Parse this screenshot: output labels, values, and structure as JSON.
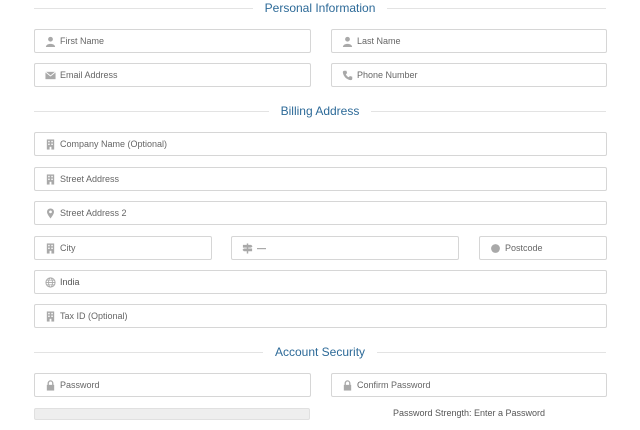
{
  "sections": {
    "personal": "Personal Information",
    "billing": "Billing Address",
    "security": "Account Security"
  },
  "fields": {
    "first_name": {
      "placeholder": "First Name",
      "icon": "person-icon"
    },
    "last_name": {
      "placeholder": "Last Name",
      "icon": "person-icon"
    },
    "email": {
      "placeholder": "Email Address",
      "icon": "envelope-icon"
    },
    "phone": {
      "placeholder": "Phone Number",
      "icon": "phone-icon"
    },
    "company": {
      "placeholder": "Company Name (Optional)",
      "icon": "building-icon"
    },
    "street": {
      "placeholder": "Street Address",
      "icon": "building-icon"
    },
    "street2": {
      "placeholder": "Street Address 2",
      "icon": "map-pin-icon"
    },
    "city": {
      "placeholder": "City",
      "icon": "building-icon"
    },
    "state": {
      "value": "—",
      "icon": "signpost-icon"
    },
    "postcode": {
      "placeholder": "Postcode",
      "icon": "circle-icon"
    },
    "country": {
      "value": "India",
      "icon": "globe-icon"
    },
    "tax_id": {
      "placeholder": "Tax ID (Optional)",
      "icon": "building-icon"
    },
    "password": {
      "placeholder": "Password",
      "icon": "lock-icon"
    },
    "confirm_password": {
      "placeholder": "Confirm Password",
      "icon": "lock-icon"
    }
  },
  "password_strength": {
    "text": "Password Strength: Enter a Password",
    "level": 0
  },
  "colors": {
    "accent": "#2d6a98",
    "icon": "#a9a9a9",
    "border": "#d6d6d6"
  }
}
